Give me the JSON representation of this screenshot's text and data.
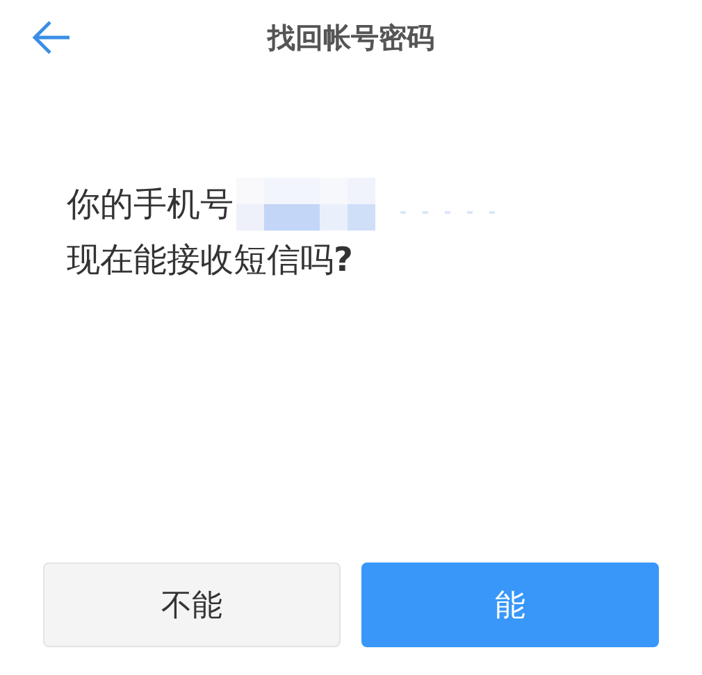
{
  "header": {
    "title": "找回帐号密码"
  },
  "question": {
    "line_1": "你的手机号",
    "line_2": "现在能接收短信吗**?**"
  },
  "buttons": [
    {
      "label": "不能",
      "kind": "secondary"
    },
    {
      "label": "能",
      "kind": "primary"
    }
  ]
}
